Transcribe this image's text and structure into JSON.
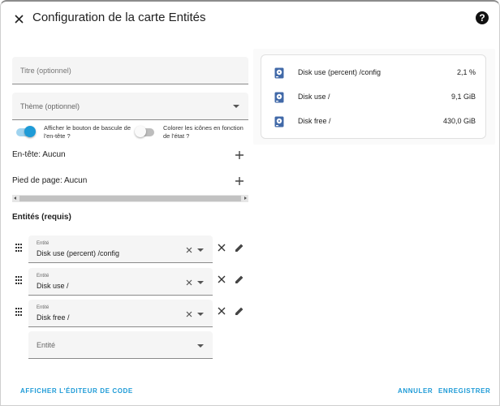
{
  "header": {
    "title": "Configuration de la carte Entités",
    "help_glyph": "?"
  },
  "form": {
    "title_placeholder": "Titre (optionnel)",
    "theme_placeholder": "Thème (optionnel)",
    "toggle_header_label": "Afficher le bouton de bascule de l'en-tête ?",
    "toggle_header_on": true,
    "toggle_color_label": "Colorer les icônes en fonction de l'état ?",
    "toggle_color_on": false,
    "header_row": "En-tête: Aucun",
    "footer_row": "Pied de page: Aucun",
    "entities_heading": "Entités (requis)",
    "entity_field_label": "Entité",
    "entities": [
      {
        "value": "Disk use (percent) /config"
      },
      {
        "value": "Disk use /"
      },
      {
        "value": "Disk free /"
      }
    ],
    "new_entity_placeholder": "Entité"
  },
  "preview": {
    "rows": [
      {
        "name": "Disk use (percent) /config",
        "value": "2,1 %"
      },
      {
        "name": "Disk use /",
        "value": "9,1 GiB"
      },
      {
        "name": "Disk free /",
        "value": "430,0 GiB"
      }
    ]
  },
  "footer": {
    "code_editor": "AFFICHER L'ÉDITEUR DE CODE",
    "cancel": "ANNULER",
    "save": "ENREGISTRER"
  },
  "colors": {
    "accent": "#1e9bd7",
    "icon_blue": "#4169a8"
  }
}
